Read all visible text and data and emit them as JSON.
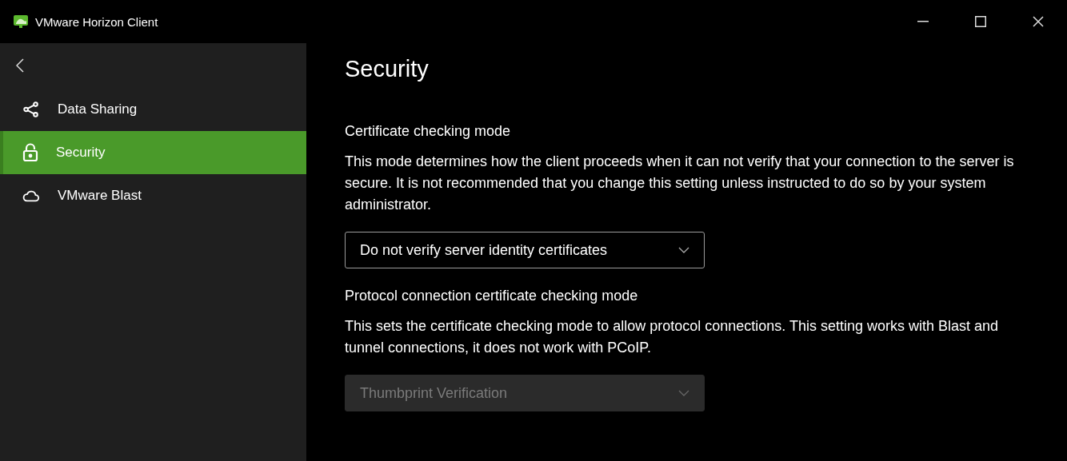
{
  "window": {
    "title": "VMware Horizon Client"
  },
  "sidebar": {
    "items": [
      {
        "label": "Data Sharing",
        "selected": false
      },
      {
        "label": "Security",
        "selected": true
      },
      {
        "label": "VMware Blast",
        "selected": false
      }
    ]
  },
  "content": {
    "title": "Security",
    "sections": [
      {
        "label": "Certificate checking mode",
        "description": "This mode determines how the client proceeds when it can not verify that your connection to the server is secure. It is not recommended that you change this setting unless instructed to do so by your system administrator.",
        "dropdown": {
          "value": "Do not verify server identity certificates",
          "disabled": false
        }
      },
      {
        "label": "Protocol connection certificate checking mode",
        "description": "This sets the certificate checking mode to allow protocol connections. This setting works with Blast and tunnel connections, it does not work with PCoIP.",
        "dropdown": {
          "value": "Thumbprint Verification",
          "disabled": true
        }
      }
    ]
  }
}
